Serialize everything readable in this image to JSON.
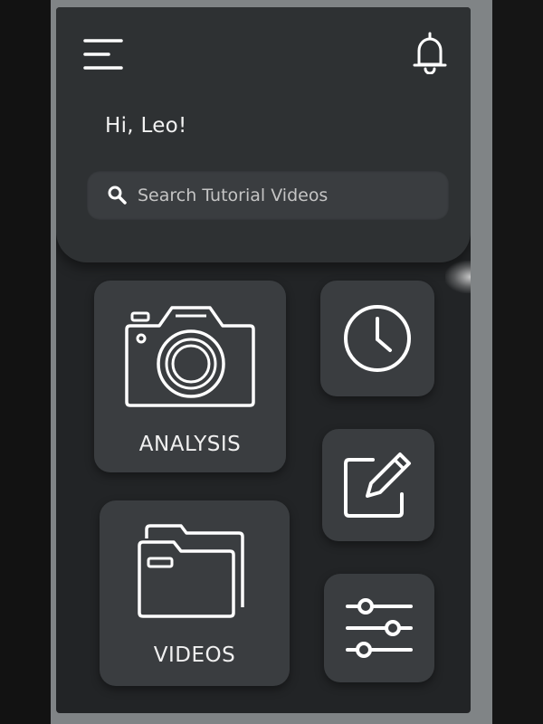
{
  "greeting": "Hi, Leo!",
  "search": {
    "placeholder": "Search Tutorial Videos"
  },
  "header": {
    "menu_icon": "hamburger-menu-icon",
    "notification_icon": "bell-icon"
  },
  "tiles": {
    "analysis": {
      "label": "ANALYSIS",
      "icon": "camera-icon"
    },
    "videos": {
      "label": "VIDEOS",
      "icon": "folder-icon"
    },
    "history": {
      "icon": "clock-icon"
    },
    "edit": {
      "icon": "pencil-edit-icon"
    },
    "settings": {
      "icon": "sliders-icon"
    }
  },
  "colors": {
    "screen_bg": "#222426",
    "card_bg": "#3a3d40",
    "header_bg": "#2e3133",
    "foreground": "#f2f2f2"
  }
}
